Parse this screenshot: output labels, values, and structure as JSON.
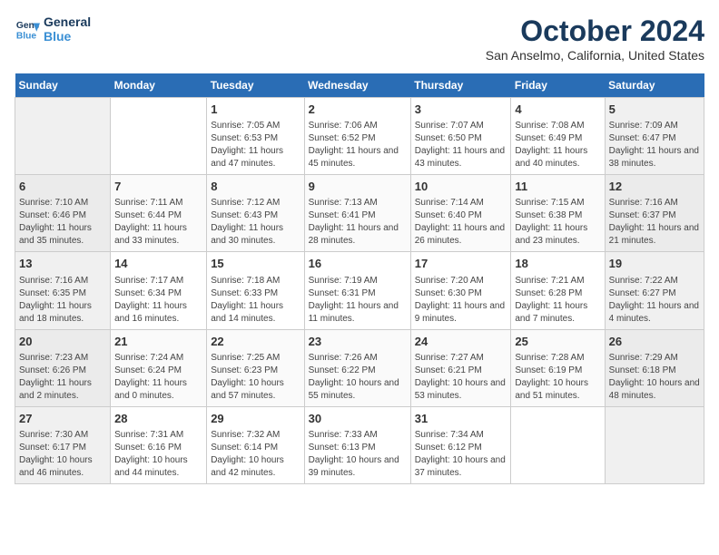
{
  "header": {
    "logo_line1": "General",
    "logo_line2": "Blue",
    "month": "October 2024",
    "location": "San Anselmo, California, United States"
  },
  "days_of_week": [
    "Sunday",
    "Monday",
    "Tuesday",
    "Wednesday",
    "Thursday",
    "Friday",
    "Saturday"
  ],
  "weeks": [
    [
      {
        "num": "",
        "info": ""
      },
      {
        "num": "",
        "info": ""
      },
      {
        "num": "1",
        "info": "Sunrise: 7:05 AM\nSunset: 6:53 PM\nDaylight: 11 hours and 47 minutes."
      },
      {
        "num": "2",
        "info": "Sunrise: 7:06 AM\nSunset: 6:52 PM\nDaylight: 11 hours and 45 minutes."
      },
      {
        "num": "3",
        "info": "Sunrise: 7:07 AM\nSunset: 6:50 PM\nDaylight: 11 hours and 43 minutes."
      },
      {
        "num": "4",
        "info": "Sunrise: 7:08 AM\nSunset: 6:49 PM\nDaylight: 11 hours and 40 minutes."
      },
      {
        "num": "5",
        "info": "Sunrise: 7:09 AM\nSunset: 6:47 PM\nDaylight: 11 hours and 38 minutes."
      }
    ],
    [
      {
        "num": "6",
        "info": "Sunrise: 7:10 AM\nSunset: 6:46 PM\nDaylight: 11 hours and 35 minutes."
      },
      {
        "num": "7",
        "info": "Sunrise: 7:11 AM\nSunset: 6:44 PM\nDaylight: 11 hours and 33 minutes."
      },
      {
        "num": "8",
        "info": "Sunrise: 7:12 AM\nSunset: 6:43 PM\nDaylight: 11 hours and 30 minutes."
      },
      {
        "num": "9",
        "info": "Sunrise: 7:13 AM\nSunset: 6:41 PM\nDaylight: 11 hours and 28 minutes."
      },
      {
        "num": "10",
        "info": "Sunrise: 7:14 AM\nSunset: 6:40 PM\nDaylight: 11 hours and 26 minutes."
      },
      {
        "num": "11",
        "info": "Sunrise: 7:15 AM\nSunset: 6:38 PM\nDaylight: 11 hours and 23 minutes."
      },
      {
        "num": "12",
        "info": "Sunrise: 7:16 AM\nSunset: 6:37 PM\nDaylight: 11 hours and 21 minutes."
      }
    ],
    [
      {
        "num": "13",
        "info": "Sunrise: 7:16 AM\nSunset: 6:35 PM\nDaylight: 11 hours and 18 minutes."
      },
      {
        "num": "14",
        "info": "Sunrise: 7:17 AM\nSunset: 6:34 PM\nDaylight: 11 hours and 16 minutes."
      },
      {
        "num": "15",
        "info": "Sunrise: 7:18 AM\nSunset: 6:33 PM\nDaylight: 11 hours and 14 minutes."
      },
      {
        "num": "16",
        "info": "Sunrise: 7:19 AM\nSunset: 6:31 PM\nDaylight: 11 hours and 11 minutes."
      },
      {
        "num": "17",
        "info": "Sunrise: 7:20 AM\nSunset: 6:30 PM\nDaylight: 11 hours and 9 minutes."
      },
      {
        "num": "18",
        "info": "Sunrise: 7:21 AM\nSunset: 6:28 PM\nDaylight: 11 hours and 7 minutes."
      },
      {
        "num": "19",
        "info": "Sunrise: 7:22 AM\nSunset: 6:27 PM\nDaylight: 11 hours and 4 minutes."
      }
    ],
    [
      {
        "num": "20",
        "info": "Sunrise: 7:23 AM\nSunset: 6:26 PM\nDaylight: 11 hours and 2 minutes."
      },
      {
        "num": "21",
        "info": "Sunrise: 7:24 AM\nSunset: 6:24 PM\nDaylight: 11 hours and 0 minutes."
      },
      {
        "num": "22",
        "info": "Sunrise: 7:25 AM\nSunset: 6:23 PM\nDaylight: 10 hours and 57 minutes."
      },
      {
        "num": "23",
        "info": "Sunrise: 7:26 AM\nSunset: 6:22 PM\nDaylight: 10 hours and 55 minutes."
      },
      {
        "num": "24",
        "info": "Sunrise: 7:27 AM\nSunset: 6:21 PM\nDaylight: 10 hours and 53 minutes."
      },
      {
        "num": "25",
        "info": "Sunrise: 7:28 AM\nSunset: 6:19 PM\nDaylight: 10 hours and 51 minutes."
      },
      {
        "num": "26",
        "info": "Sunrise: 7:29 AM\nSunset: 6:18 PM\nDaylight: 10 hours and 48 minutes."
      }
    ],
    [
      {
        "num": "27",
        "info": "Sunrise: 7:30 AM\nSunset: 6:17 PM\nDaylight: 10 hours and 46 minutes."
      },
      {
        "num": "28",
        "info": "Sunrise: 7:31 AM\nSunset: 6:16 PM\nDaylight: 10 hours and 44 minutes."
      },
      {
        "num": "29",
        "info": "Sunrise: 7:32 AM\nSunset: 6:14 PM\nDaylight: 10 hours and 42 minutes."
      },
      {
        "num": "30",
        "info": "Sunrise: 7:33 AM\nSunset: 6:13 PM\nDaylight: 10 hours and 39 minutes."
      },
      {
        "num": "31",
        "info": "Sunrise: 7:34 AM\nSunset: 6:12 PM\nDaylight: 10 hours and 37 minutes."
      },
      {
        "num": "",
        "info": ""
      },
      {
        "num": "",
        "info": ""
      }
    ]
  ]
}
